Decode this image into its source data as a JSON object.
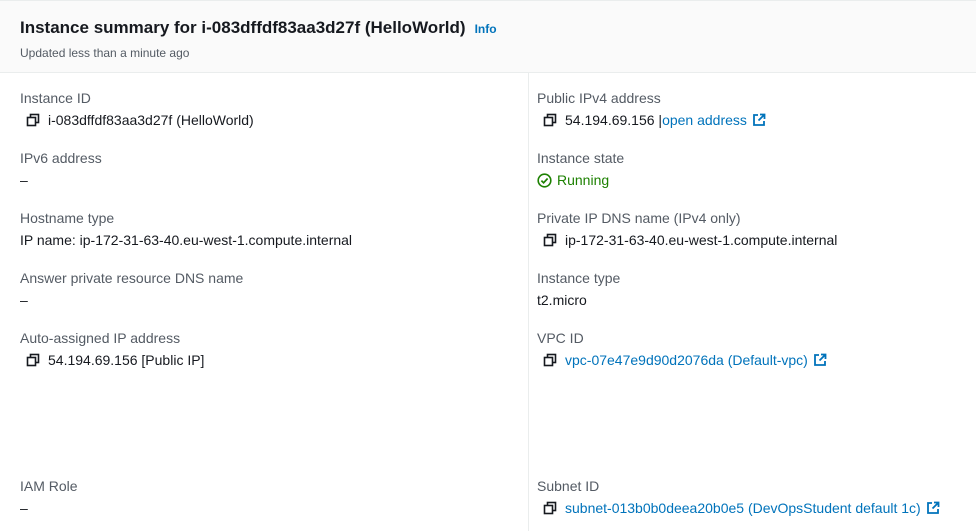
{
  "header": {
    "title": "Instance summary for i-083dffdf83aa3d27f (HelloWorld)",
    "info": "Info",
    "updated": "Updated less than a minute ago"
  },
  "left": {
    "instance_id": {
      "label": "Instance ID",
      "value": "i-083dffdf83aa3d27f (HelloWorld)"
    },
    "ipv6": {
      "label": "IPv6 address",
      "value": "–"
    },
    "hostname_type": {
      "label": "Hostname type",
      "value": "IP name: ip-172-31-63-40.eu-west-1.compute.internal"
    },
    "answer_dns": {
      "label": "Answer private resource DNS name",
      "value": "–"
    },
    "auto_ip": {
      "label": "Auto-assigned IP address",
      "value": "54.194.69.156 [Public IP]"
    },
    "iam_role": {
      "label": "IAM Role",
      "value": "–"
    }
  },
  "right": {
    "public_ipv4": {
      "label": "Public IPv4 address",
      "value": "54.194.69.156 |",
      "link": "open address"
    },
    "state": {
      "label": "Instance state",
      "value": "Running"
    },
    "private_dns": {
      "label": "Private IP DNS name (IPv4 only)",
      "value": "ip-172-31-63-40.eu-west-1.compute.internal"
    },
    "instance_type": {
      "label": "Instance type",
      "value": "t2.micro"
    },
    "vpc": {
      "label": "VPC ID",
      "value": "vpc-07e47e9d90d2076da (Default-vpc)"
    },
    "subnet": {
      "label": "Subnet ID",
      "value": "subnet-013b0b0deea20b0e5 (DevOpsStudent default 1c)"
    }
  },
  "colors": {
    "link": "#0073bb",
    "running": "#1d8102",
    "label": "#545b64",
    "text": "#16191f"
  }
}
